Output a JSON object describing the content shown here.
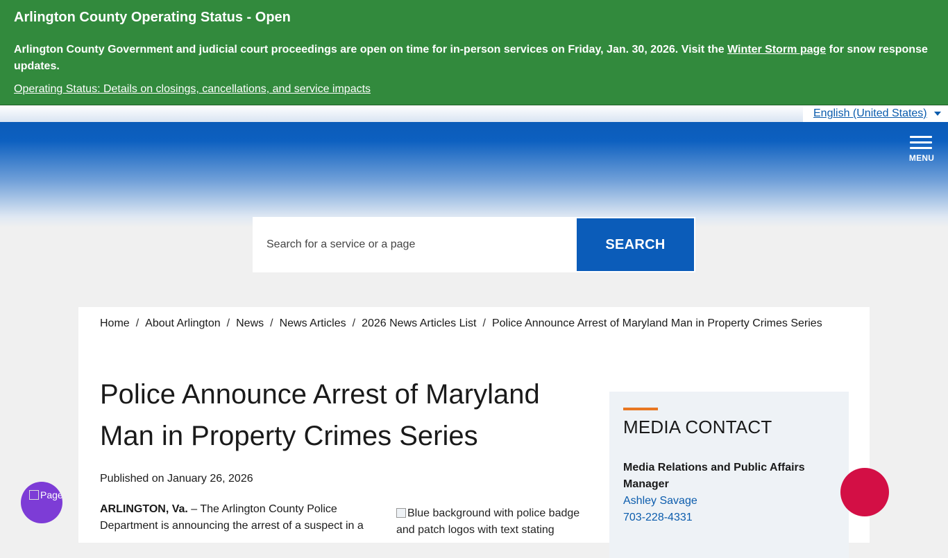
{
  "alert": {
    "title": "Arlington County Operating Status - Open",
    "body_before": "Arlington County Government and judicial court proceedings are open on time for in-person services on Friday, Jan. 30, 2026. Visit the ",
    "body_link": "Winter Storm page",
    "body_after": " for snow response updates.",
    "details_link": "Operating Status: Details on closings, cancellations, and service impacts"
  },
  "language": {
    "selected": "English (United States)"
  },
  "header": {
    "menu_label": "MENU"
  },
  "search": {
    "placeholder": "Search for a service or a page",
    "button_label": "SEARCH"
  },
  "breadcrumb": [
    "Home",
    "About Arlington",
    "News",
    "News Articles",
    "2026 News Articles List",
    "Police Announce Arrest of Maryland Man in Property Crimes Series"
  ],
  "article": {
    "title": "Police Announce Arrest of Maryland Man in Property Crimes Series",
    "published": "Published on January 26, 2026",
    "dateline": "ARLINGTON, Va.",
    "lead": " – The Arlington County Police Department is announcing the arrest of a suspect in a",
    "image_alt": "Blue background with police badge and patch logos with text stating"
  },
  "sidebar": {
    "heading": "MEDIA CONTACT",
    "role": "Media Relations and Public Affairs Manager",
    "name": "Ashley Savage",
    "phone": "703-228-4331"
  },
  "widgets": {
    "pageassist_alt": "PageAssist Personalization Options"
  },
  "colors": {
    "alert_green": "#328a3d",
    "brand_blue": "#0b5cb9",
    "link_blue": "#0b5cad",
    "accent_orange": "#e87722",
    "pageassist_purple": "#7d3cd6",
    "chat_red": "#d30f45"
  }
}
